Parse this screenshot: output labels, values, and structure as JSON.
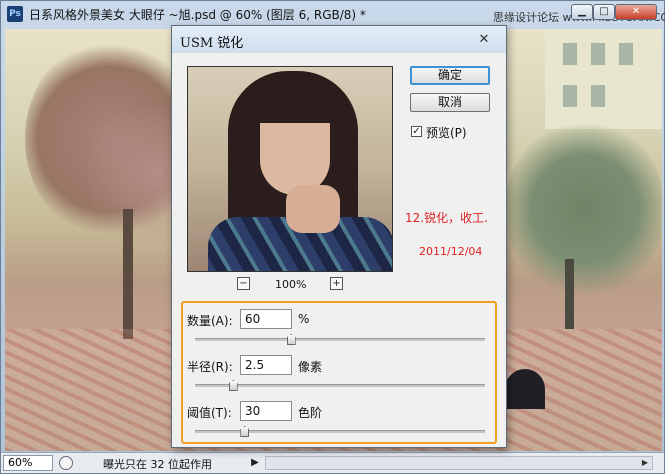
{
  "window": {
    "app_icon": "Ps",
    "title": "日系风格外景美女 大眼仔 ~旭.psd @ 60% (图层 6, RGB/8) *",
    "watermark": "思缘设计论坛 www.MISSYUAN.COM"
  },
  "statusbar": {
    "zoom": "60%",
    "message": "曝光只在 32 位起作用",
    "arrow": "▶"
  },
  "dialog": {
    "title": "USM 锐化",
    "close_glyph": "✕",
    "ok_label": "确定",
    "cancel_label": "取消",
    "preview_checked": true,
    "preview_label": "预览(P)",
    "zoom_level": "100%",
    "zoom_out": "−",
    "zoom_in": "+",
    "note_step": "12.锐化，收工.",
    "note_date": "2011/12/04",
    "note_color": "#e02020"
  },
  "params": {
    "amount": {
      "label": "数量(A):",
      "value": "60",
      "unit": "%",
      "slider_fraction": 0.33
    },
    "radius": {
      "label": "半径(R):",
      "value": "2.5",
      "unit": "像素",
      "slider_fraction": 0.13
    },
    "threshold": {
      "label": "阈值(T):",
      "value": "30",
      "unit": "色阶",
      "slider_fraction": 0.17
    }
  },
  "accent": {
    "highlight_border": "#f0a020",
    "ok_focus": "#3c93d1"
  }
}
